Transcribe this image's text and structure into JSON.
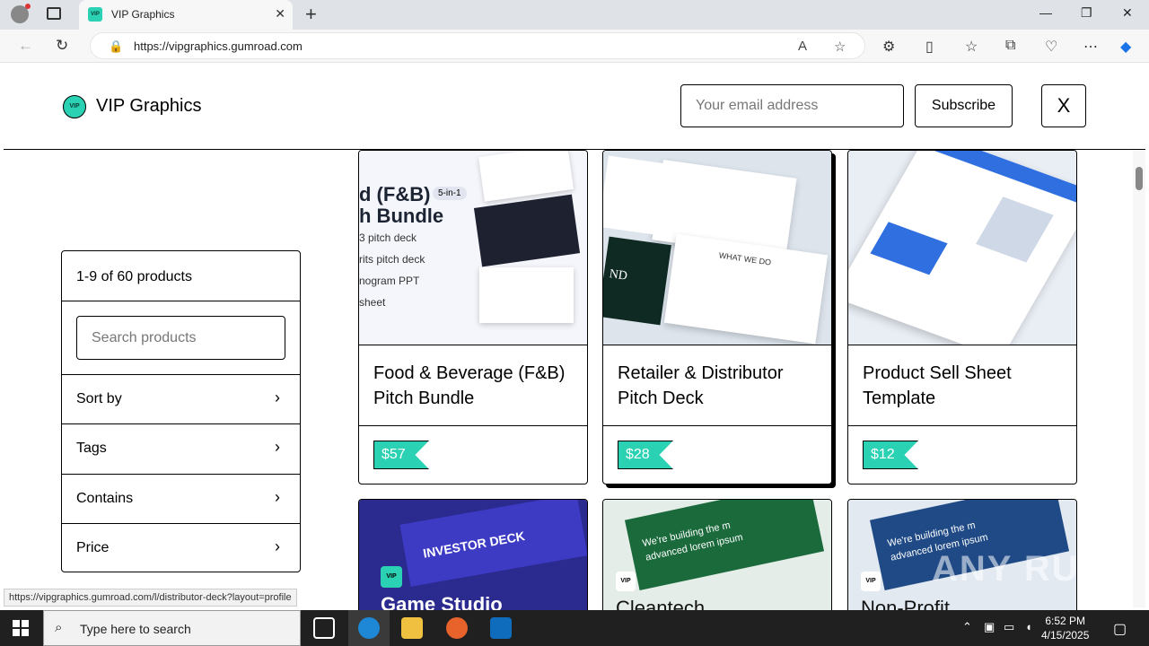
{
  "browser": {
    "tab_title": "VIP Graphics",
    "tab_favicon_text": "VIP",
    "url": "https://vipgraphics.gumroad.com",
    "new_tab_icon": "plus-icon",
    "window_minimize": "—",
    "window_maximize": "❐",
    "window_close": "✕"
  },
  "header": {
    "logo_text": "VIP",
    "title": "VIP Graphics",
    "email_placeholder": "Your email address",
    "subscribe_label": "Subscribe",
    "x_label": "X"
  },
  "filters": {
    "count": "1-9 of 60 products",
    "search_placeholder": "Search products",
    "items": [
      {
        "label": "Sort by"
      },
      {
        "label": "Tags"
      },
      {
        "label": "Contains"
      },
      {
        "label": "Price"
      }
    ]
  },
  "products": [
    {
      "title": "Food & Beverage (F&B) Pitch Bundle",
      "price": "$57",
      "thumb_lines": [
        "d (F&B)",
        "h Bundle",
        "3 pitch deck",
        "rits pitch deck",
        "nogram PPT",
        "sheet"
      ],
      "thumb_badge": "5-in-1"
    },
    {
      "title": "Retailer & Distributor Pitch Deck",
      "price": "$28",
      "thumb_lines": [
        "WHAT WE DO",
        "ND"
      ]
    },
    {
      "title": "Product Sell Sheet Template",
      "price": "$12"
    },
    {
      "title": "Game Studio",
      "thumb_lines": [
        "INVESTOR DECK"
      ],
      "logo_text": "VIP"
    },
    {
      "title": "Cleantech",
      "thumb_lines": [
        "We're building the m",
        "advanced lorem ipsum"
      ],
      "logo_text": "VIP"
    },
    {
      "title": "Non-Profit",
      "thumb_lines": [
        "We're building the m",
        "advanced lorem ipsum"
      ],
      "logo_text": "VIP"
    }
  ],
  "status_url": "https://vipgraphics.gumroad.com/l/distributor-deck?layout=profile",
  "taskbar": {
    "search_placeholder": "Type here to search",
    "time": "6:52 PM",
    "date": "4/15/2025"
  },
  "watermark": "ANY RUN",
  "colors": {
    "accent": "#2ad1b3",
    "taskbar": "#202020"
  }
}
